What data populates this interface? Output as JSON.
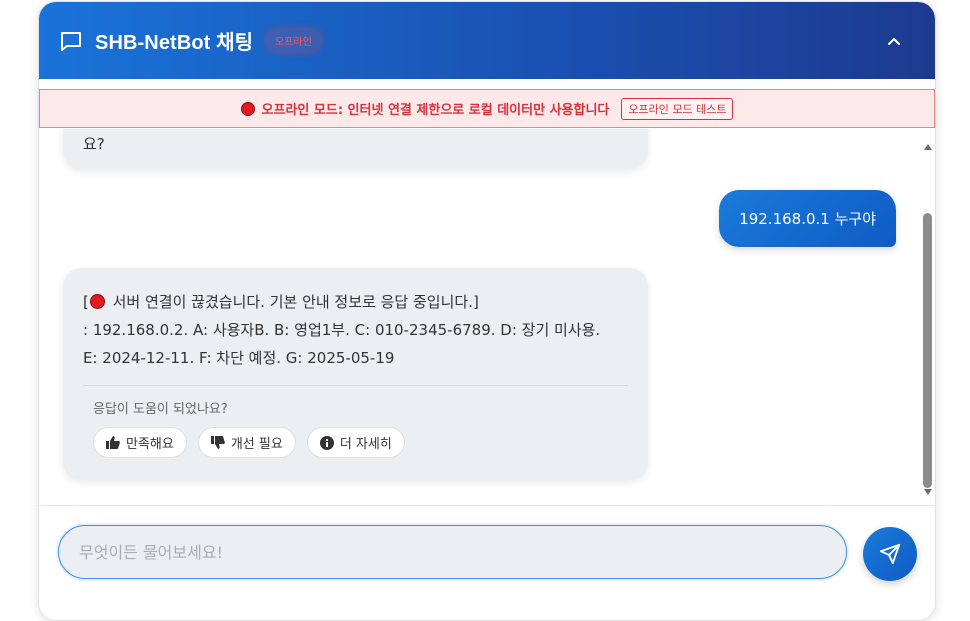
{
  "header": {
    "title": "SHB-NetBot 채팅",
    "status_badge": "오프라인",
    "icons": {
      "chat": "chat-bubble-icon",
      "collapse": "chevron-up-icon"
    }
  },
  "offline_banner": {
    "message": "오프라인 모드: 인터넷 연결 제한으로 로컬 데이터만 사용합니다",
    "test_button": "오프라인 모드 테스트"
  },
  "messages": {
    "bot_previous_tail": "요?",
    "user_message": "192.168.0.1 누구야",
    "bot_reply": {
      "line1_prefix": "[",
      "line1_text": " 서버 연결이 끊겼습니다. 기본 안내 정보로 응답 중입니다.]",
      "line2": ": 192.168.0.2. A: 사용자B. B: 영업1부. C: 010-2345-6789. D: 장기 미사용.",
      "line3": "E: 2024-12-11. F: 차단 예정. G: 2025-05-19"
    },
    "feedback": {
      "question": "응답이 도움이 되었나요?",
      "buttons": [
        {
          "label": "만족해요",
          "icon": "thumbs-up-icon"
        },
        {
          "label": "개선 필요",
          "icon": "thumbs-down-icon"
        },
        {
          "label": "더 자세히",
          "icon": "info-circle-icon"
        }
      ]
    }
  },
  "composer": {
    "placeholder": "무엇이든 물어보세요!",
    "value": "",
    "send_icon": "paper-plane-icon"
  },
  "colors": {
    "header_start": "#1a73d9",
    "header_end": "#1d3a8f",
    "offline_red": "#d7323c",
    "bubble_bot": "#eceff1",
    "bubble_user": "#1a7ad9"
  }
}
